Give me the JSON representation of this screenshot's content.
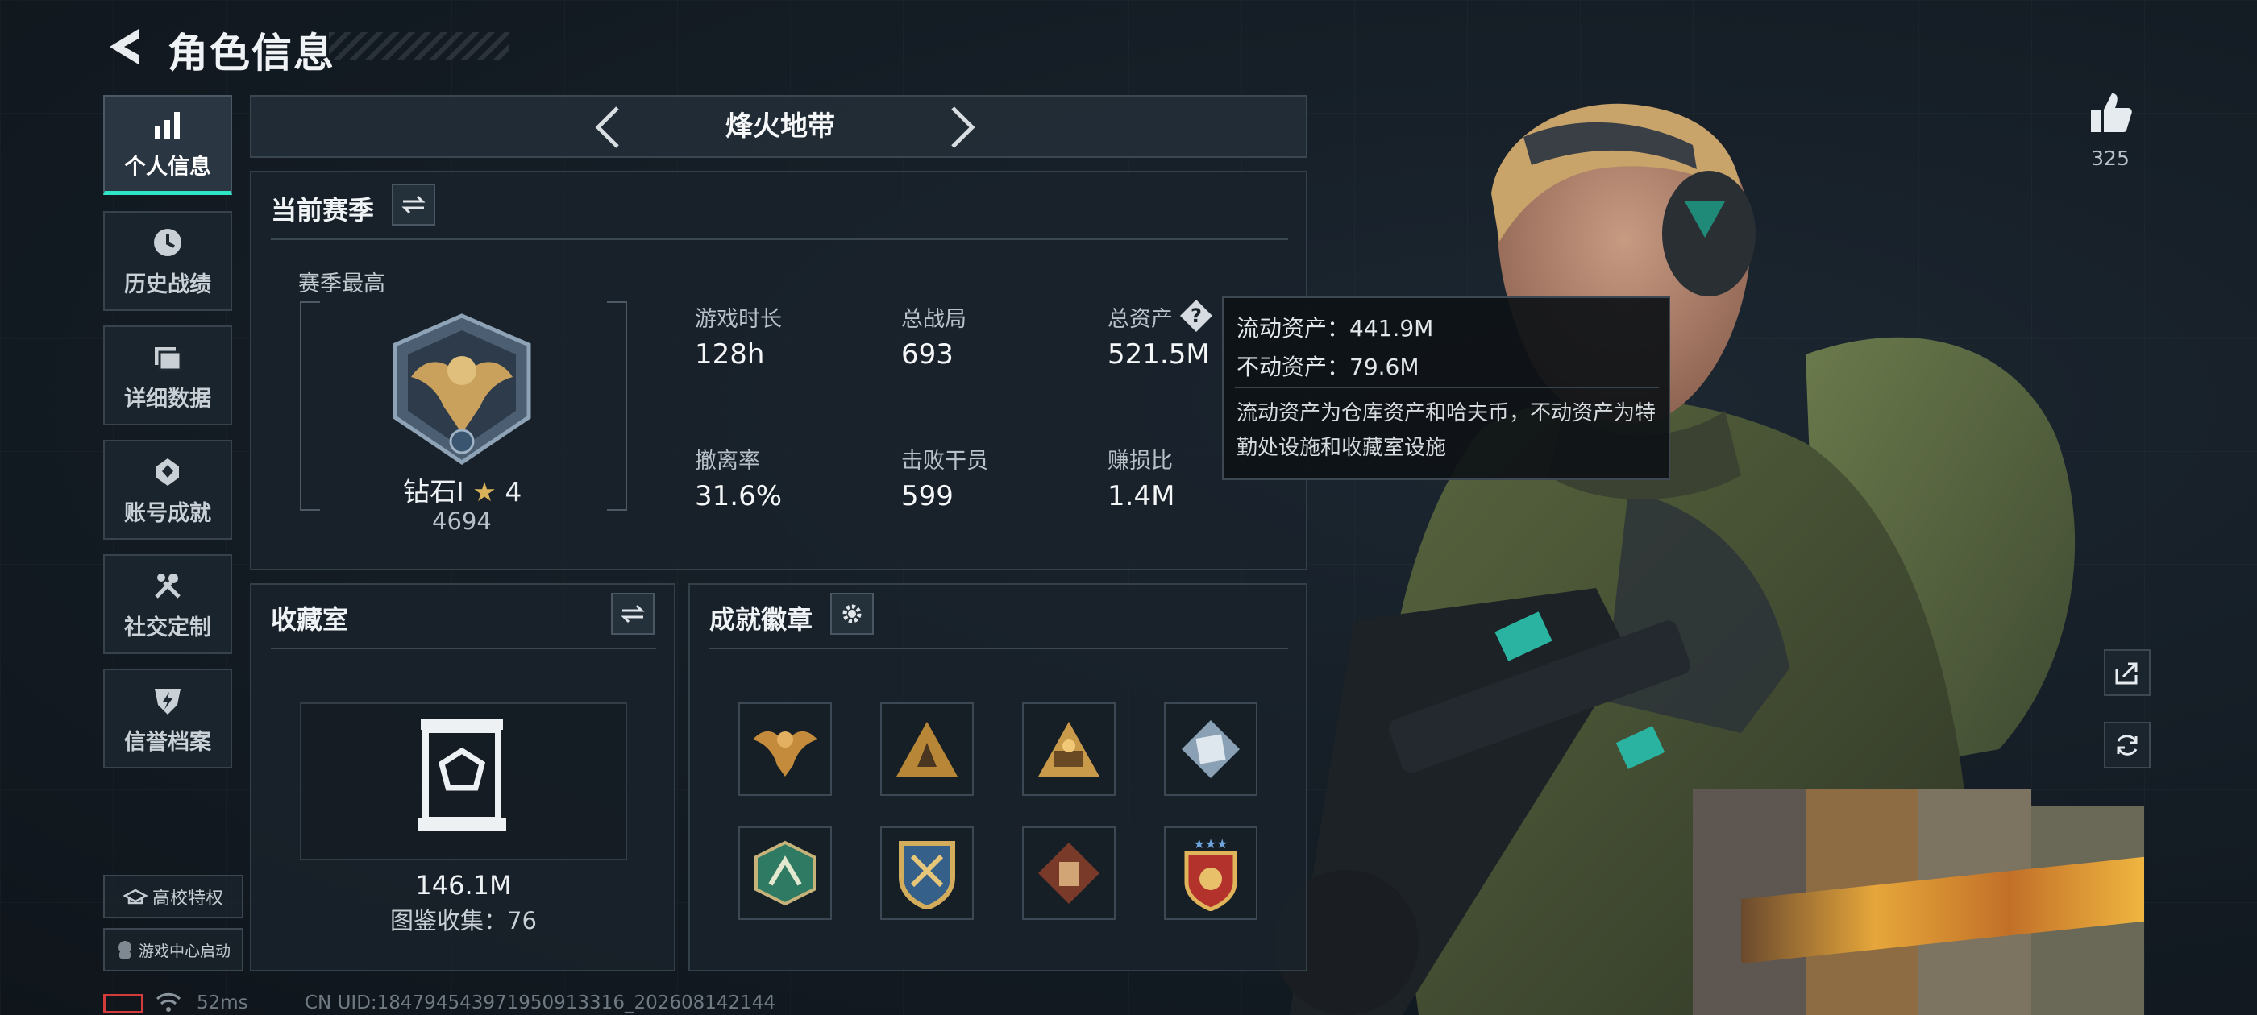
{
  "header": {
    "title": "角色信息"
  },
  "sidebar": {
    "items": [
      {
        "label": "个人信息",
        "icon": "bar-chart-icon",
        "active": true
      },
      {
        "label": "历史战绩",
        "icon": "clock-icon"
      },
      {
        "label": "详细数据",
        "icon": "folder-icon"
      },
      {
        "label": "账号成就",
        "icon": "achievement-icon"
      },
      {
        "label": "社交定制",
        "icon": "wrench-icon"
      },
      {
        "label": "信誉档案",
        "icon": "shield-icon"
      }
    ],
    "campus_label": "高校特权",
    "game_center_label": "游戏中心启动"
  },
  "mode_selector": {
    "label": "烽火地带"
  },
  "season": {
    "title": "当前赛季",
    "best_label": "赛季最高",
    "rank_name": "钻石Ⅰ",
    "rank_stars": "4",
    "rank_score": "4694",
    "stats": [
      {
        "label": "游戏时长",
        "value": "128h"
      },
      {
        "label": "总战局",
        "value": "693"
      },
      {
        "label": "总资产",
        "value": "521.5M"
      },
      {
        "label": "撤离率",
        "value": "31.6%"
      },
      {
        "label": "击败干员",
        "value": "599"
      },
      {
        "label": "赚损比",
        "value": "1.4M"
      }
    ]
  },
  "tooltip": {
    "liquid": "流动资产：441.9M",
    "fixed": "不动资产：79.6M",
    "description": "流动资产为仓库资产和哈夫币，不动资产为特勤处设施和收藏室设施"
  },
  "collection": {
    "title": "收藏室",
    "value": "146.1M",
    "catalog": "图鉴收集：76"
  },
  "badges": {
    "title": "成就徽章",
    "items": [
      "eagle-badge",
      "triangle-badge",
      "gold-triangle-badge",
      "dice-badge",
      "hexagon-badge",
      "shield-crest-badge",
      "diamond-badge",
      "star-crest-badge"
    ]
  },
  "likes": {
    "count": "325"
  },
  "status": {
    "ping": "52ms",
    "uid": "CN UID:184794543971950913316_202608142144"
  },
  "colors": {
    "accent": "#2ee6c7",
    "gold": "#c99a4a"
  }
}
